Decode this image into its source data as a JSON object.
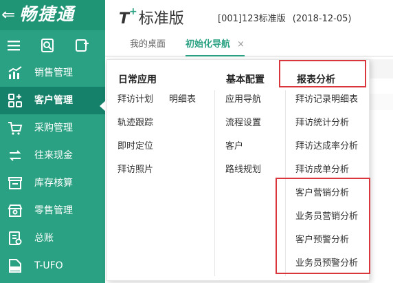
{
  "brand": {
    "back_glyph": "⇐",
    "name": "畅捷通"
  },
  "header": {
    "logo_t": "T",
    "logo_plus": "+",
    "logo_product": "标准版",
    "account": "[001]123标准版",
    "date": "(2018-12-05)"
  },
  "tabs": [
    {
      "label": "我的桌面"
    },
    {
      "label": "初始化导航",
      "close": "×"
    }
  ],
  "sidebar": {
    "items": [
      {
        "label": "销售管理",
        "icon": "sales-chart-icon"
      },
      {
        "label": "客户管理",
        "icon": "customer-grid-icon"
      },
      {
        "label": "采购管理",
        "icon": "cart-icon"
      },
      {
        "label": "往来现金",
        "icon": "exchange-icon"
      },
      {
        "label": "库存核算",
        "icon": "warehouse-icon"
      },
      {
        "label": "零售管理",
        "icon": "store-icon"
      },
      {
        "label": "总账",
        "icon": "ledger-icon"
      },
      {
        "label": "T-UFO",
        "icon": "ufo-icon"
      }
    ]
  },
  "menu": {
    "daily": {
      "title": "日常应用",
      "items": [
        "拜访计划",
        "明细表",
        "轨迹跟踪",
        "即时定位",
        "拜访照片"
      ]
    },
    "basic": {
      "title": "基本配置",
      "items": [
        "应用导航",
        "流程设置",
        "客户",
        "路线规划"
      ]
    },
    "report": {
      "title": "报表分析",
      "items": [
        "拜访记录明细表",
        "拜访统计分析",
        "拜访达成率分析",
        "拜访成单分析",
        "客户营销分析",
        "业务员营销分析",
        "客户预警分析",
        "业务员预警分析"
      ]
    }
  },
  "colors": {
    "accent": "#2aa182",
    "active": "#15816a",
    "highlight": "#d9363e"
  }
}
